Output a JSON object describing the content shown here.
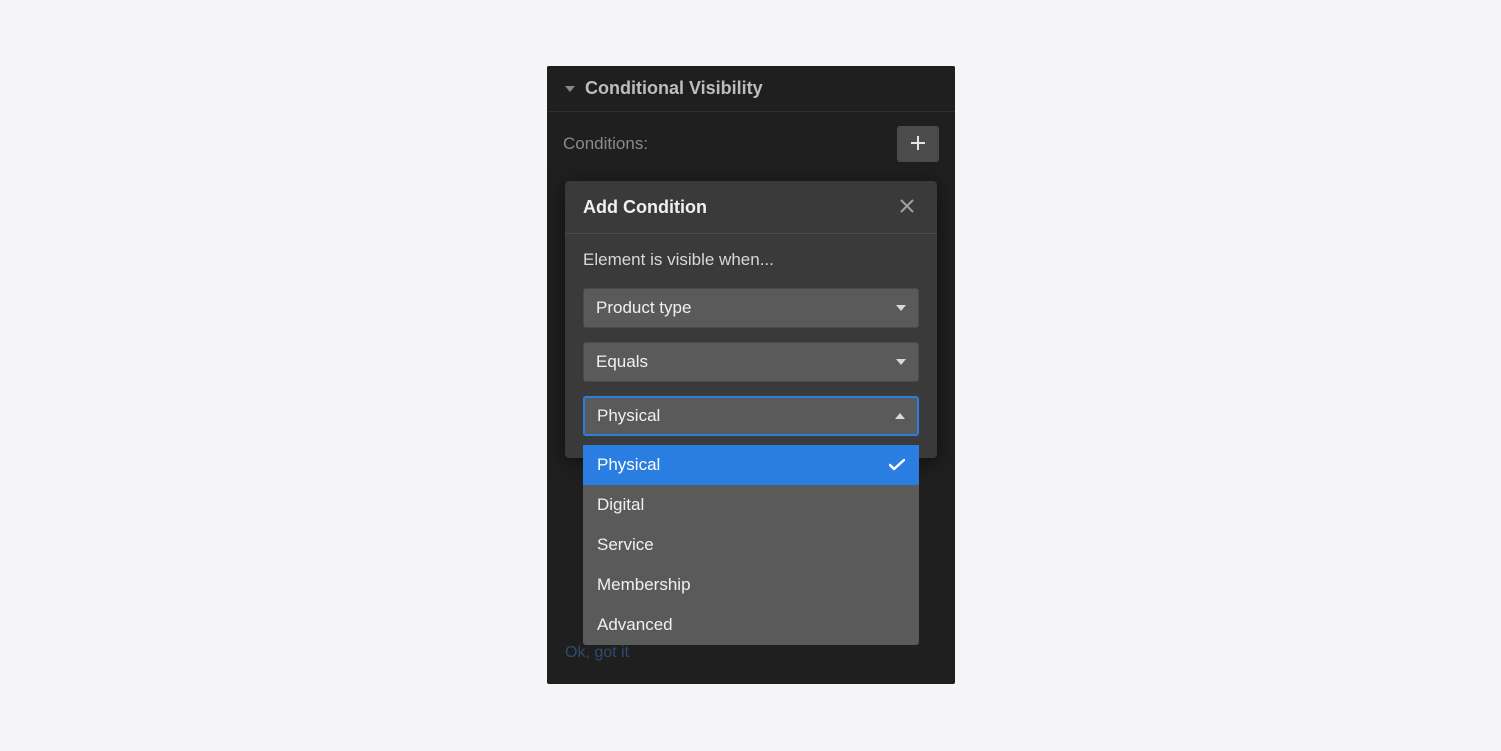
{
  "section": {
    "title": "Conditional Visibility",
    "conditions_label": "Conditions:"
  },
  "modal": {
    "title": "Add Condition",
    "prompt": "Element is visible when...",
    "field_select": "Product type",
    "operator_select": "Equals",
    "value_select": "Physical"
  },
  "dropdown": {
    "options": [
      {
        "label": "Physical",
        "selected": true
      },
      {
        "label": "Digital",
        "selected": false
      },
      {
        "label": "Service",
        "selected": false
      },
      {
        "label": "Membership",
        "selected": false
      },
      {
        "label": "Advanced",
        "selected": false
      }
    ]
  },
  "footer_link": "Ok, got it"
}
